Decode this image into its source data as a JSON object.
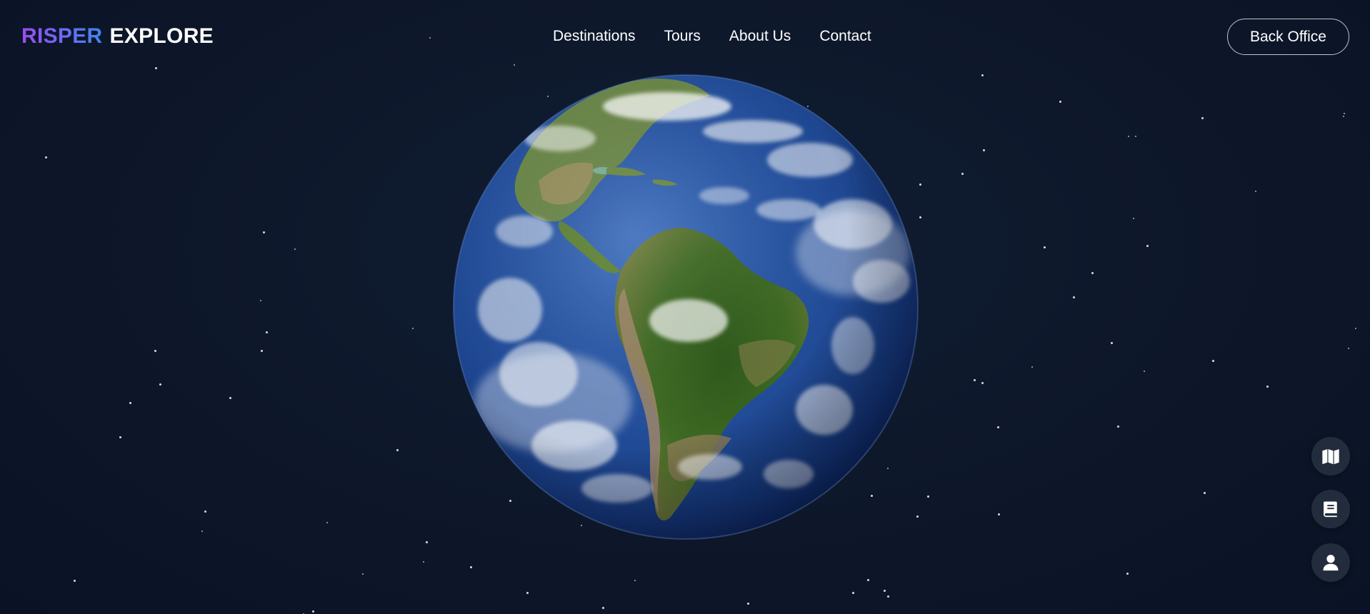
{
  "brand": {
    "part1": "RISPER",
    "part2": "EXPLORE",
    "gradient": [
      "#9b4cf0",
      "#3f86ef"
    ]
  },
  "nav": {
    "items": [
      {
        "label": "Destinations"
      },
      {
        "label": "Tours"
      },
      {
        "label": "About Us"
      },
      {
        "label": "Contact"
      }
    ]
  },
  "header_action": {
    "label": "Back Office"
  },
  "hero": {
    "image": "earth-globe-americas"
  },
  "floating_actions": [
    {
      "icon": "map-icon"
    },
    {
      "icon": "book-icon"
    },
    {
      "icon": "user-icon"
    }
  ],
  "colors": {
    "background": "#0c1628",
    "button_bg": "#222c3d",
    "text": "#ffffff"
  }
}
